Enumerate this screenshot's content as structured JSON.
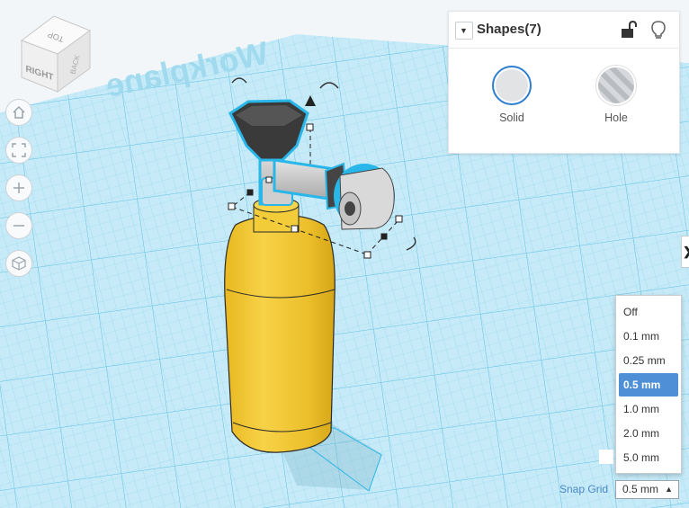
{
  "panel": {
    "title": "Shapes(7)",
    "collapse_icon": "chevron-down-icon",
    "lock_icon": "lock-open-icon",
    "light_icon": "lightbulb-icon",
    "solid_label": "Solid",
    "hole_label": "Hole"
  },
  "viewcube": {
    "top": "TOP",
    "right": "RIGHT",
    "back": "BACK"
  },
  "workplane_label": "Workplane",
  "nav_buttons": [
    {
      "name": "home-view-button",
      "icon": "home-icon"
    },
    {
      "name": "fit-view-button",
      "icon": "fit-icon"
    },
    {
      "name": "zoom-in-button",
      "icon": "plus-icon"
    },
    {
      "name": "zoom-out-button",
      "icon": "minus-icon"
    },
    {
      "name": "perspective-button",
      "icon": "cube-icon"
    }
  ],
  "snap_grid": {
    "label": "Snap Grid",
    "value": "0.5 mm",
    "options": [
      "Off",
      "0.1 mm",
      "0.25 mm",
      "0.5 mm",
      "1.0 mm",
      "2.0 mm",
      "5.0 mm"
    ],
    "selected_index": 3
  },
  "edge_tab_label": "❯",
  "colors": {
    "grid_bg": "#bfe6f5",
    "grid_line": "#7fcfe9",
    "tank_yellow": "#f1c62f",
    "valve_gray": "#c9c9c9",
    "knob_dark": "#3b3b3b",
    "selection_outline": "#29b6e8",
    "accent": "#4f8fd6"
  }
}
